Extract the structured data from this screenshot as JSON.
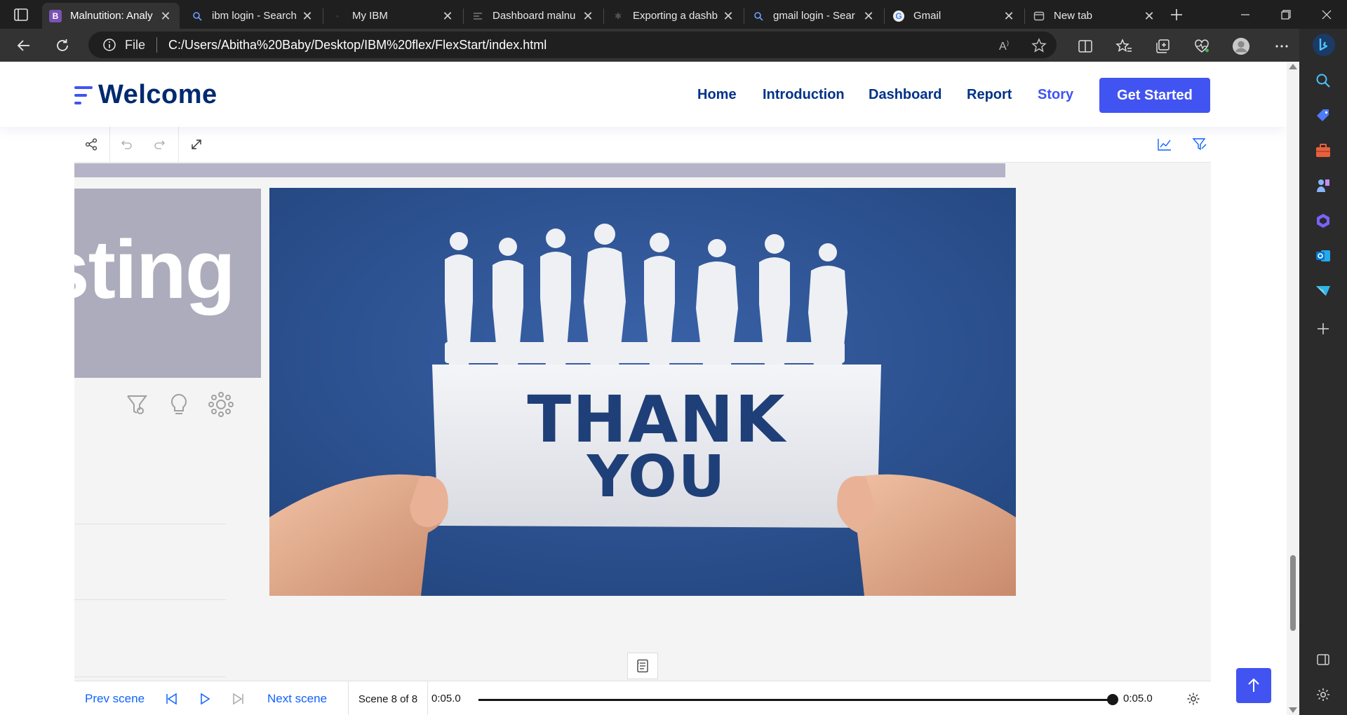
{
  "browser": {
    "tabs": [
      {
        "title": "Malnutition: Analy",
        "favicon": "bootstrap-icon",
        "favicon_color": "#7952b3",
        "active": true
      },
      {
        "title": "ibm login - Search",
        "favicon": "search-icon",
        "favicon_color": "#1f1f1f",
        "active": false
      },
      {
        "title": "My IBM",
        "favicon": "ibm-icon",
        "favicon_color": "#1f1f1f",
        "active": false
      },
      {
        "title": "Dashboard malnu",
        "favicon": "cognos-icon",
        "favicon_color": "#1f1f1f",
        "active": false
      },
      {
        "title": "Exporting a dashb",
        "favicon": "ibm-community-icon",
        "favicon_color": "#1f1f1f",
        "active": false
      },
      {
        "title": "gmail login - Sear",
        "favicon": "search-icon",
        "favicon_color": "#1f1f1f",
        "active": false
      },
      {
        "title": "Gmail",
        "favicon": "google-icon",
        "favicon_color": "#1f1f1f",
        "active": false
      },
      {
        "title": "New tab",
        "favicon": "newtab-icon",
        "favicon_color": "#1f1f1f",
        "active": false
      }
    ],
    "address": {
      "scheme_label": "File",
      "url": "C:/Users/Abitha%20Baby/Desktop/IBM%20flex/FlexStart/index.html"
    }
  },
  "site": {
    "logo_text": "Welcome",
    "nav": [
      {
        "label": "Home",
        "active": false
      },
      {
        "label": "Introduction",
        "active": false
      },
      {
        "label": "Dashboard",
        "active": false
      },
      {
        "label": "Report",
        "active": false
      },
      {
        "label": "Story",
        "active": true
      }
    ],
    "cta_label": "Get Started",
    "accent": "#4154f1",
    "nav_color": "#013289"
  },
  "story": {
    "left_card_text": "sting",
    "hero": {
      "line1": "THANK",
      "line2": "YOU",
      "background": "#2e4f8f"
    },
    "player": {
      "prev_label": "Prev scene",
      "next_label": "Next scene",
      "scene_label": "Scene 8 of 8",
      "time_start": "0:05.0",
      "time_end": "0:05.0",
      "progress": 1.0
    }
  }
}
